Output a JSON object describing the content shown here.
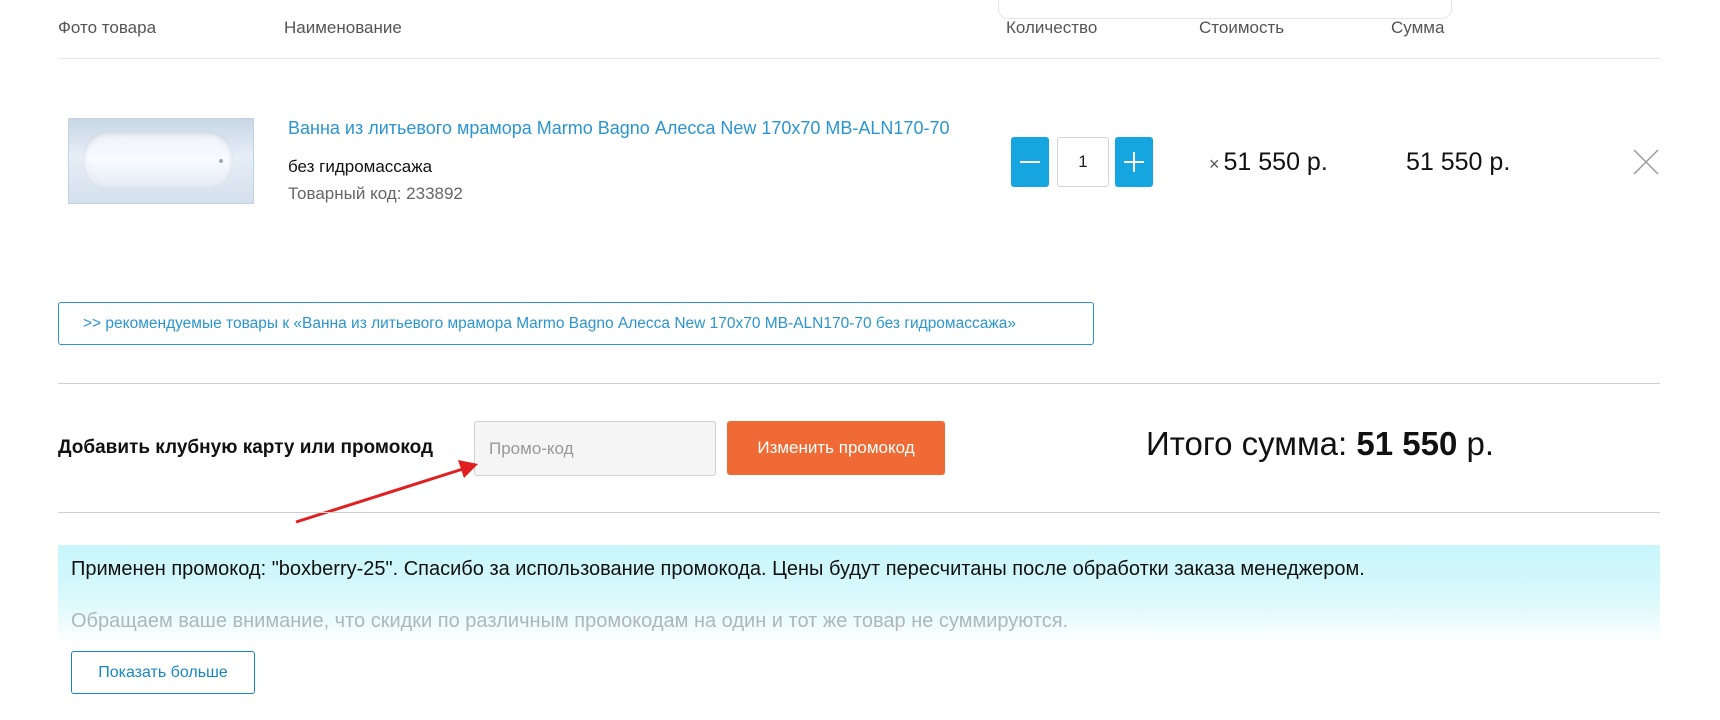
{
  "cart": {
    "headers": {
      "photo": "Фото товара",
      "name": "Наименование",
      "quantity": "Количество",
      "cost": "Стоимость",
      "sum": "Сумма"
    },
    "item": {
      "title": "Ванна из литьевого мрамора Marmo Bagno Алесса New 170х70 MB-ALN170-70",
      "option": "без гидромассажа",
      "code": "Товарный код: 233892",
      "quantity": "1",
      "times_sign": "×",
      "cost": "51 550 р.",
      "sum": "51 550 р.",
      "image_icon": "bathtub-photo",
      "remove_icon": "close-icon",
      "minus_icon": "minus-icon",
      "plus_icon": "plus-icon"
    },
    "recommend_label": ">> рекомендуемые товары к «Ванна из литьевого мрамора Marmo Bagno Алесса New 170х70 MB-ALN170-70 без гидромассажа»"
  },
  "promo": {
    "label": "Добавить клубную карту или промокод",
    "placeholder": "Промо-код",
    "value": "",
    "submit_label": "Изменить промокод"
  },
  "total": {
    "label": "Итого сумма:",
    "amount": "51 550",
    "currency": "р."
  },
  "notice": {
    "line1": "Применен промокод: \"boxberry-25\". Спасибо за использование промокода. Цены будут пересчитаны после обработки заказа менеджером.",
    "line2": "Обращаем ваше внимание, что скидки по различным промокодам на один и тот же товар не суммируются.",
    "show_more_label": "Показать больше"
  },
  "colors": {
    "link_blue": "#2a95d0",
    "button_blue": "#15a6e0",
    "promo_orange": "#ef6a35",
    "notice_bg": "#c7f6fb",
    "annotation_arrow": "#e02020"
  }
}
